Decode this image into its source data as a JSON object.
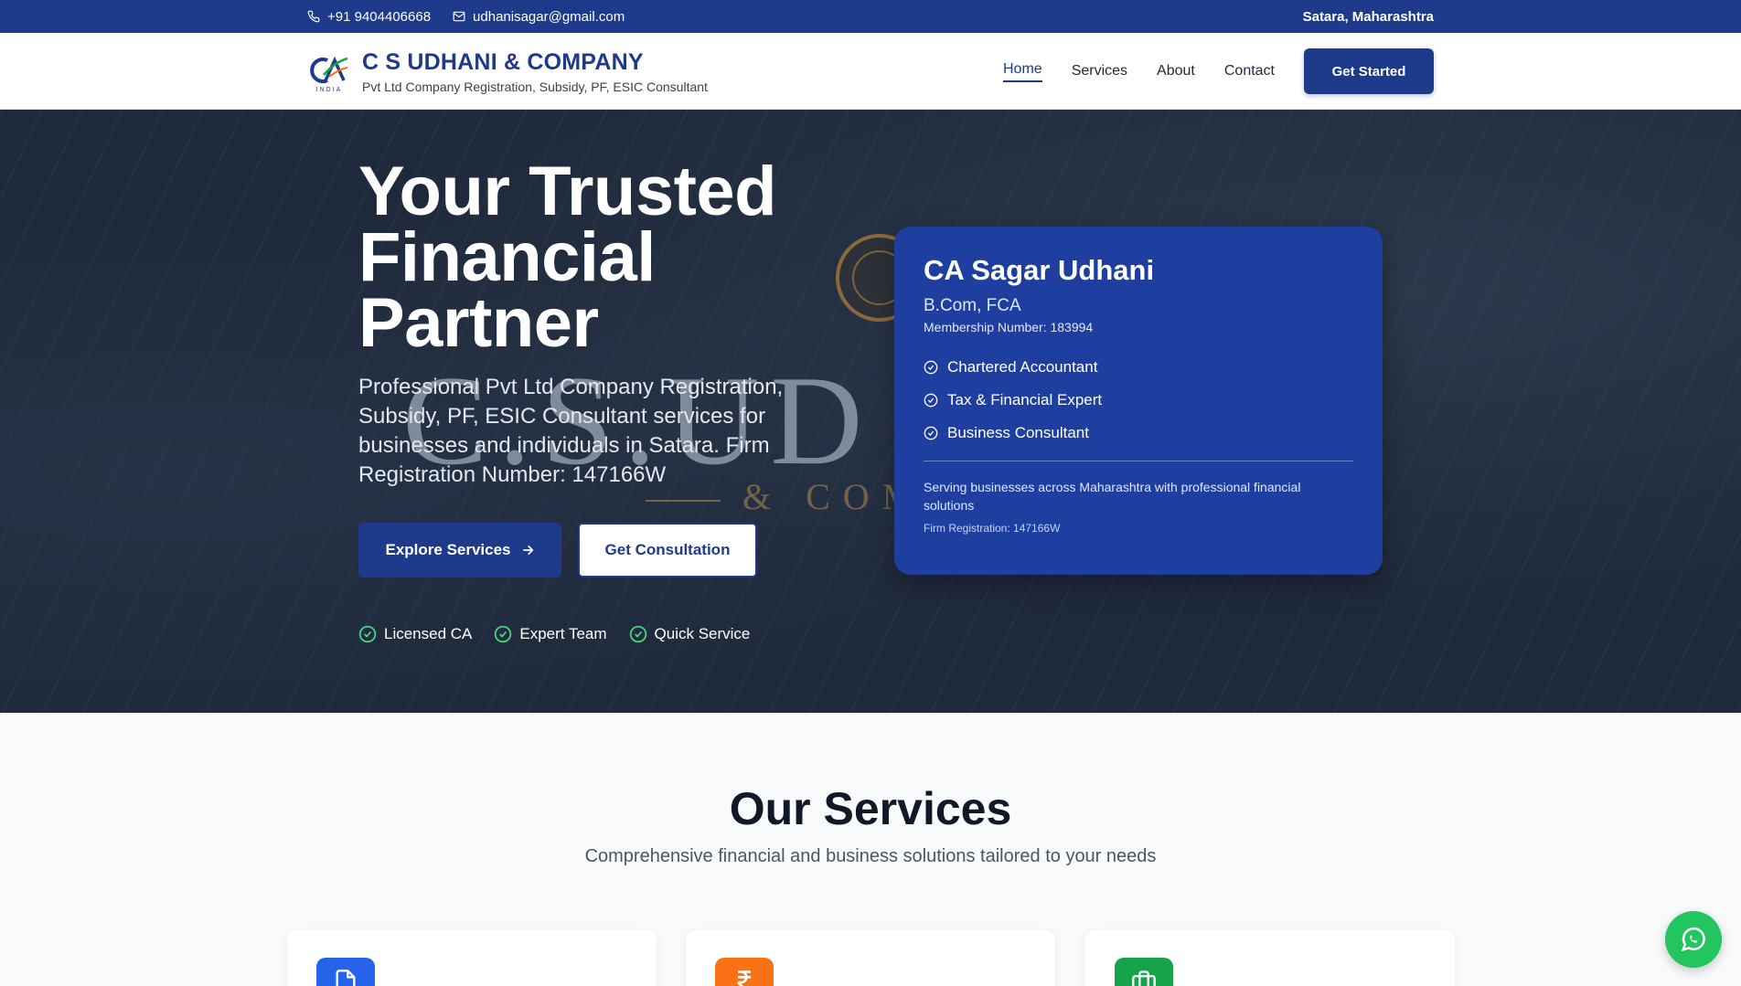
{
  "topbar": {
    "phone": "+91 9404406668",
    "email": "udhanisagar@gmail.com",
    "location": "Satara, Maharashtra"
  },
  "header": {
    "logo_text": "INDIA",
    "company_name": "C S UDHANI & COMPANY",
    "tagline": "Pvt Ltd Company Registration, Subsidy, PF, ESIC Consultant",
    "nav": [
      {
        "label": "Home",
        "active": true
      },
      {
        "label": "Services",
        "active": false
      },
      {
        "label": "About",
        "active": false
      },
      {
        "label": "Contact",
        "active": false
      }
    ],
    "cta_label": "Get Started"
  },
  "hero": {
    "title_lines": [
      "Your Trusted",
      "Financial",
      "Partner"
    ],
    "description": "Professional Pvt Ltd Company Registration, Subsidy, PF, ESIC Consultant services for businesses and individuals in Satara. Firm Registration Number: 147166W",
    "explore_label": "Explore Services",
    "consult_label": "Get Consultation",
    "watermark": "C.S.UD",
    "watermark_sub": "& COM",
    "checks": [
      "Licensed CA",
      "Expert Team",
      "Quick Service"
    ]
  },
  "profile_card": {
    "name": "CA Sagar Udhani",
    "qualification": "B.Com, FCA",
    "membership": "Membership Number: 183994",
    "roles": [
      "Chartered Accountant",
      "Tax & Financial Expert",
      "Business Consultant"
    ],
    "serving": "Serving businesses across Maharashtra with professional financial solutions",
    "firm_registration": "Firm Registration: 147166W"
  },
  "services": {
    "heading": "Our Services",
    "subheading": "Comprehensive financial and business solutions tailored to your needs",
    "cards": [
      {
        "icon": "document-icon",
        "color": "#2563eb"
      },
      {
        "icon": "rupee-icon",
        "color": "#f97316"
      },
      {
        "icon": "briefcase-icon",
        "color": "#16a34a"
      }
    ]
  },
  "colors": {
    "primary": "#1e3a8a",
    "card": "#1e3fa0",
    "hero_bg": "#1e293b",
    "check_green": "#4ade80",
    "whatsapp": "#22c55e"
  }
}
